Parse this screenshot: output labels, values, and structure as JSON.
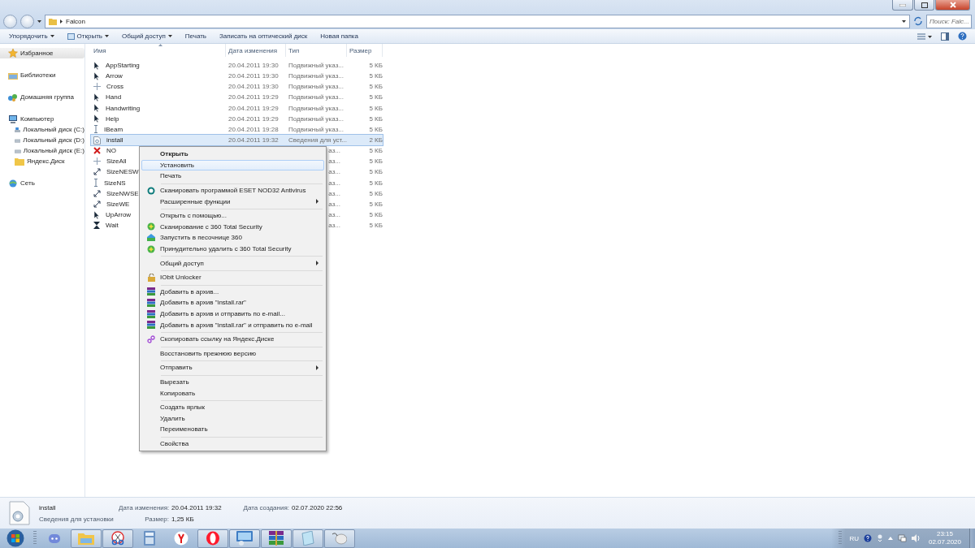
{
  "address_bar": {
    "path": "Falcon"
  },
  "search": {
    "placeholder": "Поиск: Falc..."
  },
  "toolbar": [
    {
      "label": "Упорядочить",
      "kind": "plain",
      "dropdown": true
    },
    {
      "label": "Открыть",
      "kind": "open",
      "dropdown": true
    },
    {
      "label": "Общий доступ",
      "kind": "plain",
      "dropdown": true
    },
    {
      "label": "Печать",
      "kind": "plain",
      "dropdown": false
    },
    {
      "label": "Записать на оптический диск",
      "kind": "plain",
      "dropdown": false
    },
    {
      "label": "Новая папка",
      "kind": "plain",
      "dropdown": false
    }
  ],
  "sidebar": {
    "items": [
      {
        "label": "Избранное",
        "kind": "star",
        "selected": true
      },
      {
        "label": "Библиотеки",
        "kind": "library",
        "selected": false
      },
      {
        "label": "Домашняя группа",
        "kind": "homegroup",
        "selected": false
      },
      {
        "label": "Компьютер",
        "kind": "computer",
        "selected": false,
        "children": [
          {
            "label": "Локальный диск (C:)",
            "kind": "system-drive",
            "selected": false
          },
          {
            "label": "Локальный диск (D:)",
            "kind": "drive",
            "selected": false
          },
          {
            "label": "Локальный диск (E:)",
            "kind": "drive",
            "selected": false
          },
          {
            "label": "Яндекс.Диск",
            "kind": "folder",
            "selected": false
          }
        ]
      },
      {
        "label": "Сеть",
        "kind": "network",
        "selected": false
      }
    ]
  },
  "file_list": {
    "columns": [
      "Имя",
      "Дата изменения",
      "Тип",
      "Размер"
    ],
    "rows": [
      {
        "name": "AppStarting",
        "kind": "cursor",
        "date": "20.04.2011 19:30",
        "type": "Подвижный указ...",
        "size": "5 КБ",
        "selected": false
      },
      {
        "name": "Arrow",
        "kind": "cursor",
        "date": "20.04.2011 19:30",
        "type": "Подвижный указ...",
        "size": "5 КБ",
        "selected": false
      },
      {
        "name": "Cross",
        "kind": "cross",
        "date": "20.04.2011 19:30",
        "type": "Подвижный указ...",
        "size": "5 КБ",
        "selected": false
      },
      {
        "name": "Hand",
        "kind": "cursor",
        "date": "20.04.2011 19:29",
        "type": "Подвижный указ...",
        "size": "5 КБ",
        "selected": false
      },
      {
        "name": "Handwriting",
        "kind": "cursor",
        "date": "20.04.2011 19:29",
        "type": "Подвижный указ...",
        "size": "5 КБ",
        "selected": false
      },
      {
        "name": "Help",
        "kind": "cursor",
        "date": "20.04.2011 19:29",
        "type": "Подвижный указ...",
        "size": "5 КБ",
        "selected": false
      },
      {
        "name": "IBeam",
        "kind": "ibeam",
        "date": "20.04.2011 19:28",
        "type": "Подвижный указ...",
        "size": "5 КБ",
        "selected": false
      },
      {
        "name": "install",
        "kind": "setup",
        "date": "20.04.2011 19:32",
        "type": "Сведения для уст...",
        "size": "2 КБ",
        "selected": true
      },
      {
        "name": "NO",
        "kind": "no",
        "type": "аз...",
        "size": "5 КБ",
        "selected": false,
        "type_clipped": true
      },
      {
        "name": "SizeAll",
        "kind": "cross",
        "type": "аз...",
        "size": "5 КБ",
        "selected": false,
        "type_clipped": true
      },
      {
        "name": "SizeNESW",
        "kind": "resize",
        "type": "аз...",
        "size": "5 КБ",
        "selected": false,
        "type_clipped": true
      },
      {
        "name": "SizeNS",
        "kind": "ibeam",
        "type": "аз...",
        "size": "5 КБ",
        "selected": false,
        "type_clipped": true
      },
      {
        "name": "SizeNWSE",
        "kind": "resize",
        "type": "аз...",
        "size": "5 КБ",
        "selected": false,
        "type_clipped": true
      },
      {
        "name": "SizeWE",
        "kind": "resize",
        "type": "аз...",
        "size": "5 КБ",
        "selected": false,
        "type_clipped": true
      },
      {
        "name": "UpArrow",
        "kind": "cursor",
        "type": "аз...",
        "size": "5 КБ",
        "selected": false,
        "type_clipped": true
      },
      {
        "name": "Wait",
        "kind": "wait",
        "type": "аз...",
        "size": "5 КБ",
        "selected": false,
        "type_clipped": true
      }
    ]
  },
  "context_menu": {
    "groups": [
      [
        {
          "label": "Открыть",
          "kind": "text",
          "bold": true,
          "selected": false,
          "submenu": false
        },
        {
          "label": "Установить",
          "kind": "text",
          "bold": false,
          "selected": true,
          "submenu": false
        },
        {
          "label": "Печать",
          "kind": "text",
          "bold": false,
          "selected": false,
          "submenu": false
        }
      ],
      [
        {
          "label": "Сканировать программой ESET NOD32 Antivirus",
          "kind": "eset",
          "bold": false,
          "selected": false,
          "submenu": false
        },
        {
          "label": "Расширенные функции",
          "kind": "text",
          "bold": false,
          "selected": false,
          "submenu": true
        }
      ],
      [
        {
          "label": "Открыть с помощью...",
          "kind": "text",
          "bold": false,
          "selected": false,
          "submenu": false
        },
        {
          "label": "Сканирование с 360 Total Security",
          "kind": "shield360",
          "bold": false,
          "selected": false,
          "submenu": false
        },
        {
          "label": "Запустить в песочнице 360",
          "kind": "sandbox",
          "bold": false,
          "selected": false,
          "submenu": false
        },
        {
          "label": "Принудительно удалить с  360 Total Security",
          "kind": "shield360",
          "bold": false,
          "selected": false,
          "submenu": false
        }
      ],
      [
        {
          "label": "Общий доступ",
          "kind": "text",
          "bold": false,
          "selected": false,
          "submenu": true
        }
      ],
      [
        {
          "label": "IObit Unlocker",
          "kind": "unlocker",
          "bold": false,
          "selected": false,
          "submenu": false
        }
      ],
      [
        {
          "label": "Добавить в архив...",
          "kind": "archive",
          "bold": false,
          "selected": false,
          "submenu": false
        },
        {
          "label": "Добавить в архив \"install.rar\"",
          "kind": "archive",
          "bold": false,
          "selected": false,
          "submenu": false
        },
        {
          "label": "Добавить в архив и отправить по e-mail...",
          "kind": "archive",
          "bold": false,
          "selected": false,
          "submenu": false
        },
        {
          "label": "Добавить в архив \"install.rar\" и отправить по e-mail",
          "kind": "archive",
          "bold": false,
          "selected": false,
          "submenu": false
        }
      ],
      [
        {
          "label": "Скопировать ссылку на Яндекс.Диске",
          "kind": "link",
          "bold": false,
          "selected": false,
          "submenu": false
        }
      ],
      [
        {
          "label": "Восстановить прежнюю версию",
          "kind": "text",
          "bold": false,
          "selected": false,
          "submenu": false
        }
      ],
      [
        {
          "label": "Отправить",
          "kind": "text",
          "bold": false,
          "selected": false,
          "submenu": true
        }
      ],
      [
        {
          "label": "Вырезать",
          "kind": "text",
          "bold": false,
          "selected": false,
          "submenu": false
        },
        {
          "label": "Копировать",
          "kind": "text",
          "bold": false,
          "selected": false,
          "submenu": false
        }
      ],
      [
        {
          "label": "Создать ярлык",
          "kind": "text",
          "bold": false,
          "selected": false,
          "submenu": false
        },
        {
          "label": "Удалить",
          "kind": "text",
          "bold": false,
          "selected": false,
          "submenu": false
        },
        {
          "label": "Переименовать",
          "kind": "text",
          "bold": false,
          "selected": false,
          "submenu": false
        }
      ],
      [
        {
          "label": "Свойства",
          "kind": "text",
          "bold": false,
          "selected": false,
          "submenu": false
        }
      ]
    ]
  },
  "details": {
    "name": "install",
    "type": "Сведения для установки",
    "fields": [
      {
        "label": "Дата изменения:",
        "value": "20.04.2011 19:32"
      },
      {
        "label": "Размер:",
        "value": "1,25 КБ"
      },
      {
        "label": "Дата создания:",
        "value": "02.07.2020 22:56"
      }
    ]
  },
  "taskbar": {
    "apps": [
      {
        "kind": "discord",
        "running": false
      },
      {
        "kind": "explorer",
        "running": true
      },
      {
        "kind": "scissors",
        "running": true
      },
      {
        "kind": "calculator",
        "running": false
      },
      {
        "kind": "yandex",
        "running": false
      },
      {
        "kind": "opera",
        "running": true
      },
      {
        "kind": "control",
        "running": true
      },
      {
        "kind": "winrar",
        "running": true
      },
      {
        "kind": "notepad",
        "running": true
      },
      {
        "kind": "mouse",
        "running": true
      }
    ],
    "language": "RU",
    "time": "23:15",
    "date": "02.07.2020"
  }
}
